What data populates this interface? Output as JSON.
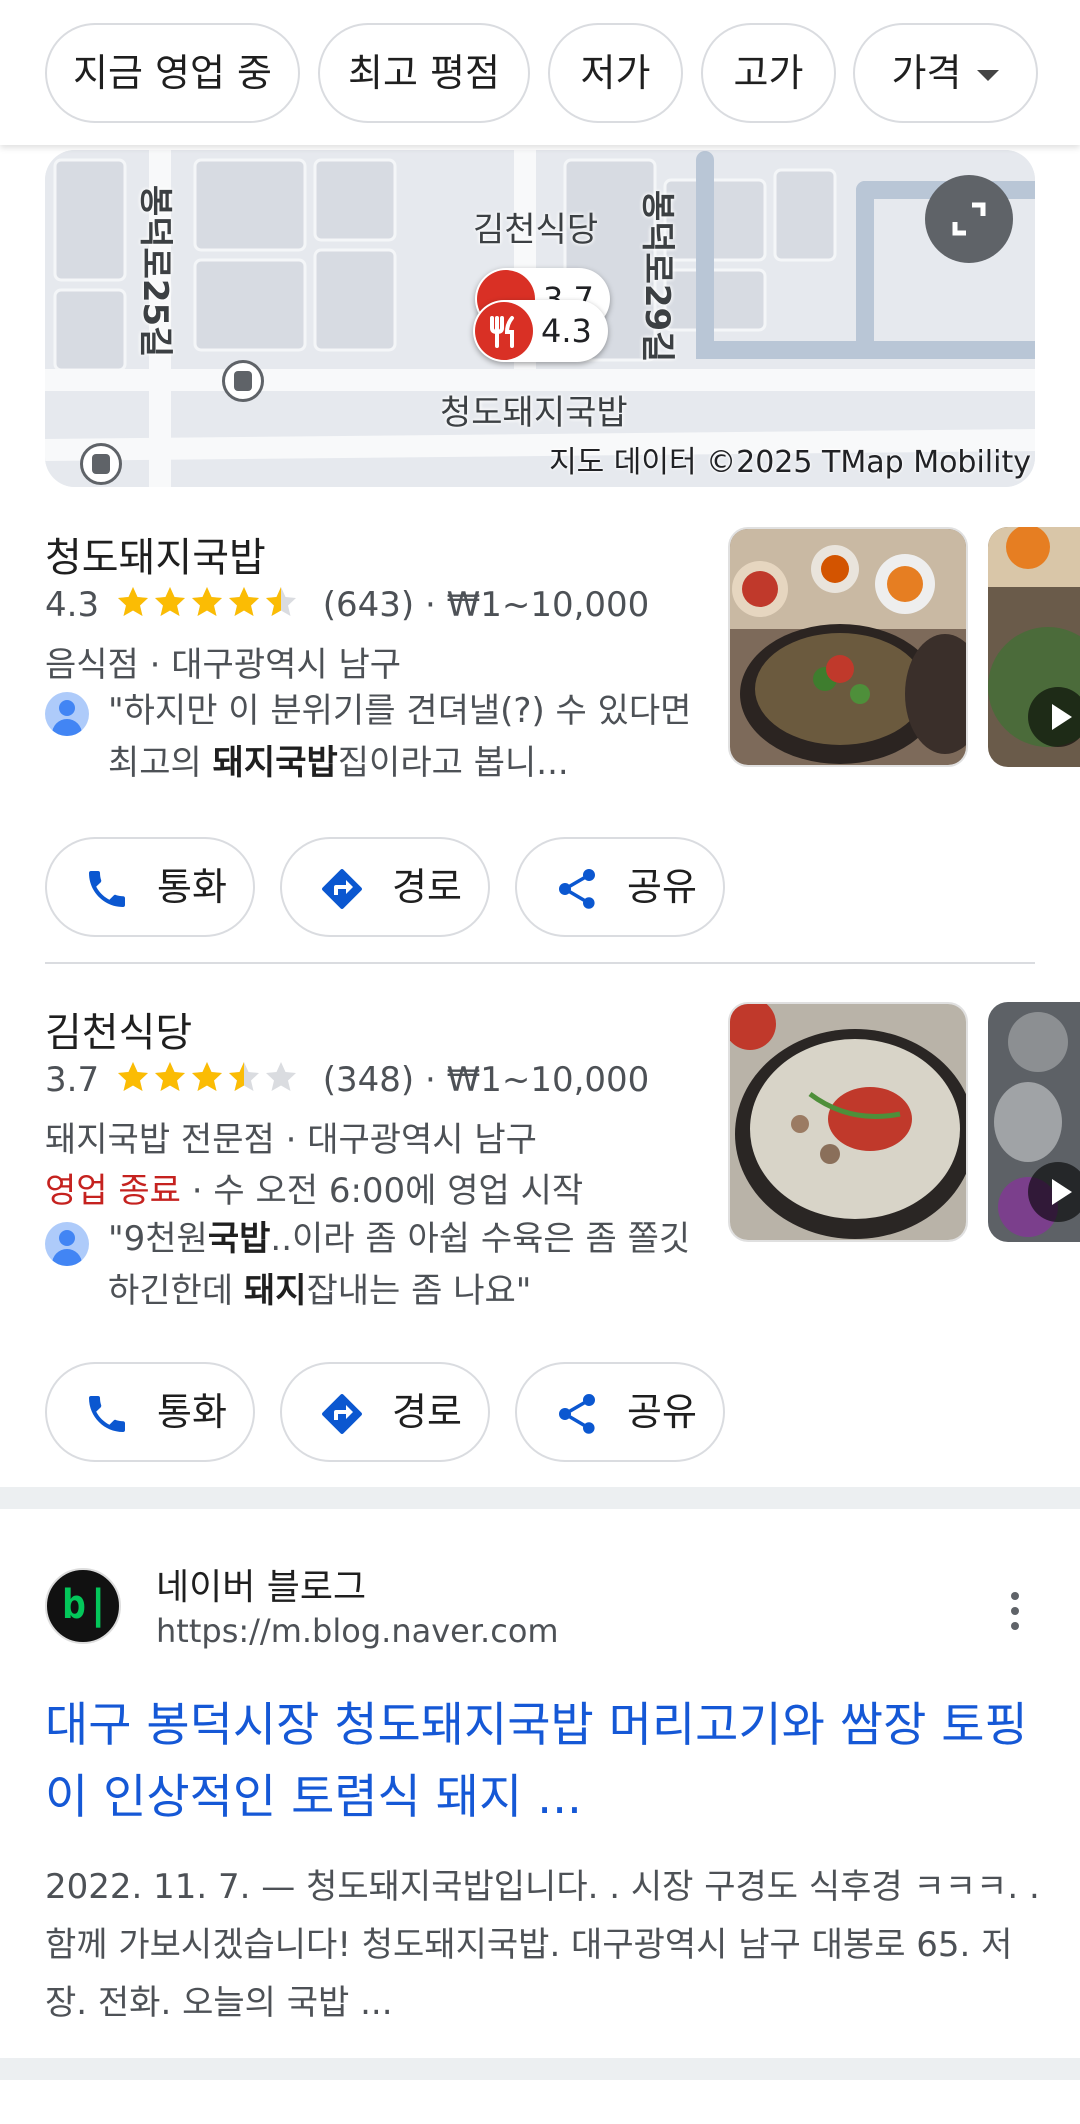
{
  "filters": {
    "chips": [
      "지금 영업 중",
      "최고 평점",
      "저가",
      "고가",
      "가격"
    ]
  },
  "map": {
    "labels": {
      "road_left": "봉덕로25길",
      "road_right": "봉덕로29길",
      "place_top": "김천식당",
      "place_bottom": "청도돼지국밥"
    },
    "pins": [
      "3.7",
      "4.3"
    ],
    "credit": "지도 데이터 ©2025 TMap Mobility"
  },
  "listings": [
    {
      "name": "청도돼지국밥",
      "rating": "4.3",
      "stars": 4.3,
      "reviews": "(643)",
      "price": "₩1~10,000",
      "category_line": "음식점 · 대구광역시 남구",
      "review_parts": [
        "\"하지만 이 분위기를 견뎌낼(?) 수 있다면 최고의 ",
        "돼지국밥",
        "집이라고 봅니..."
      ]
    },
    {
      "name": "김천식당",
      "rating": "3.7",
      "stars": 3.7,
      "reviews": "(348)",
      "price": "₩1~10,000",
      "category_line": "돼지국밥 전문점 · 대구광역시 남구",
      "status_closed": "영업 종료",
      "status_rest": " · 수 오전 6:00에 영업 시작",
      "review_parts": [
        "\"9천원",
        "국밥",
        "..이라 좀 아쉽 수육은 좀 쫄깃하긴한데 ",
        "돼지",
        "잡내는 좀 나요\""
      ]
    }
  ],
  "actions": {
    "call": "통화",
    "directions": "경로",
    "share": "공유"
  },
  "result": {
    "site_name": "네이버 블로그",
    "url": "https://m.blog.naver.com",
    "logo_text": "b|",
    "title": "대구 봉덕시장 청도돼지국밥 머리고기와 쌈장 토핑이 인상적인 토렴식 돼지 ...",
    "snippet": "2022. 11. 7. — 청도돼지국밥입니다. . 시장 구경도 식후경 ㅋㅋㅋ. . 함께 가보시겠습니다! 청도돼지국밥. 대구광역시 남구 대봉로 65. 저장. 전화. 오늘의 국밥 ..."
  },
  "colors": {
    "star": "#fbbc04",
    "star_empty": "#dadce0",
    "link": "#1558d6",
    "closed": "#c5221f",
    "action_icon": "#0b57d0"
  }
}
